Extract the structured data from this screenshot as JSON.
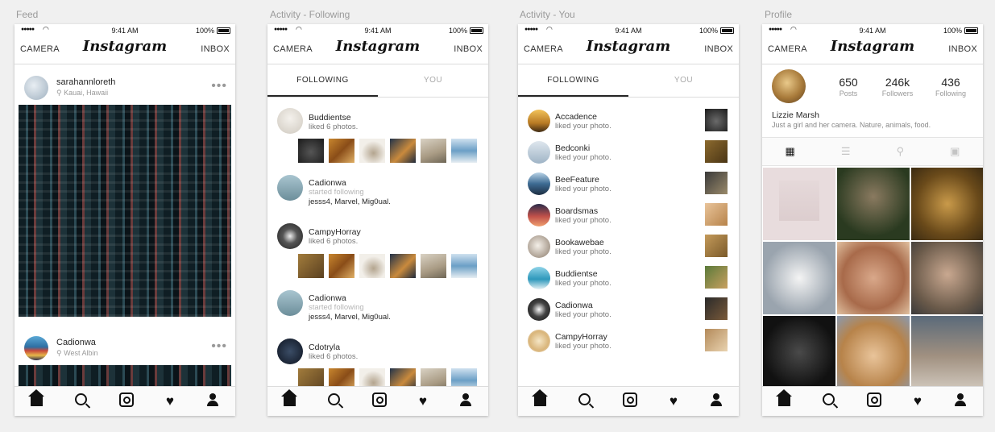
{
  "status": {
    "time": "9:41 AM",
    "battery": "100%"
  },
  "nav": {
    "camera": "CAMERA",
    "logo": "Instagram",
    "inbox": "INBOX"
  },
  "boards": [
    "Feed",
    "Activity - Following",
    "Activity - You",
    "Profile"
  ],
  "feed": {
    "posts": [
      {
        "user": "sarahannloreth",
        "location": "Kauai, Hawaii",
        "more": "•••"
      },
      {
        "user": "Cadionwa",
        "location": "West Albin",
        "more": "•••"
      }
    ]
  },
  "activity": {
    "tabs": [
      "FOLLOWING",
      "YOU"
    ],
    "following": [
      {
        "name": "Buddientse",
        "action": "liked 6 photos."
      },
      {
        "name": "Cadionwa",
        "action": "started following",
        "who": "jesss4, Marvel, Mig0ual."
      },
      {
        "name": "CampyHorray",
        "action": "liked 6 photos."
      },
      {
        "name": "Cadionwa",
        "action": "started following",
        "who": "jesss4, Marvel, Mig0ual."
      },
      {
        "name": "Cdotryla",
        "action": "liked 6 photos."
      }
    ],
    "you": [
      {
        "name": "Accadence",
        "action": "liked your photo."
      },
      {
        "name": "Bedconki",
        "action": "liked your photo."
      },
      {
        "name": "BeeFeature",
        "action": "liked your photo."
      },
      {
        "name": "Boardsmas",
        "action": "liked your photo."
      },
      {
        "name": "Bookawebae",
        "action": "liked your photo."
      },
      {
        "name": "Buddientse",
        "action": "liked your photo."
      },
      {
        "name": "Cadionwa",
        "action": "liked your photo."
      },
      {
        "name": "CampyHorray",
        "action": "liked your photo."
      }
    ]
  },
  "profile": {
    "name": "Lizzie Marsh",
    "bio": "Just a girl and her camera. Nature, animals, food.",
    "stats": [
      {
        "value": "650",
        "label": "Posts"
      },
      {
        "value": "246k",
        "label": "Followers"
      },
      {
        "value": "436",
        "label": "Following"
      }
    ]
  },
  "icons": {
    "tabbar": [
      "home-icon",
      "search-icon",
      "camera-icon",
      "heart-icon",
      "profile-icon"
    ],
    "location": "location-pin-icon",
    "profile_views": [
      "grid-view-icon",
      "list-view-icon",
      "map-pin-icon",
      "tagged-icon"
    ]
  }
}
